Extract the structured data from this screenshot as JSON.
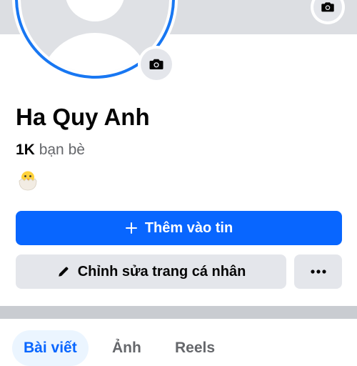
{
  "profile": {
    "name": "Ha Quy Anh",
    "friends_count": "1K",
    "friends_label": "bạn bè",
    "status_emoji": "hatching-chick-icon"
  },
  "actions": {
    "add_story_label": "Thêm vào tin",
    "edit_profile_label": "Chỉnh sửa trang cá nhân",
    "more_icon": "more-horizontal-icon"
  },
  "tabs": [
    {
      "label": "Bài viết",
      "active": true
    },
    {
      "label": "Ảnh",
      "active": false
    },
    {
      "label": "Reels",
      "active": false
    }
  ],
  "colors": {
    "primary": "#0866ff",
    "avatar_ring": "#1877f2",
    "secondary_button": "#e4e6eb",
    "cover": "#dcdee2",
    "divider": "#c9ccd1",
    "active_tab_bg": "#ebf5ff"
  }
}
